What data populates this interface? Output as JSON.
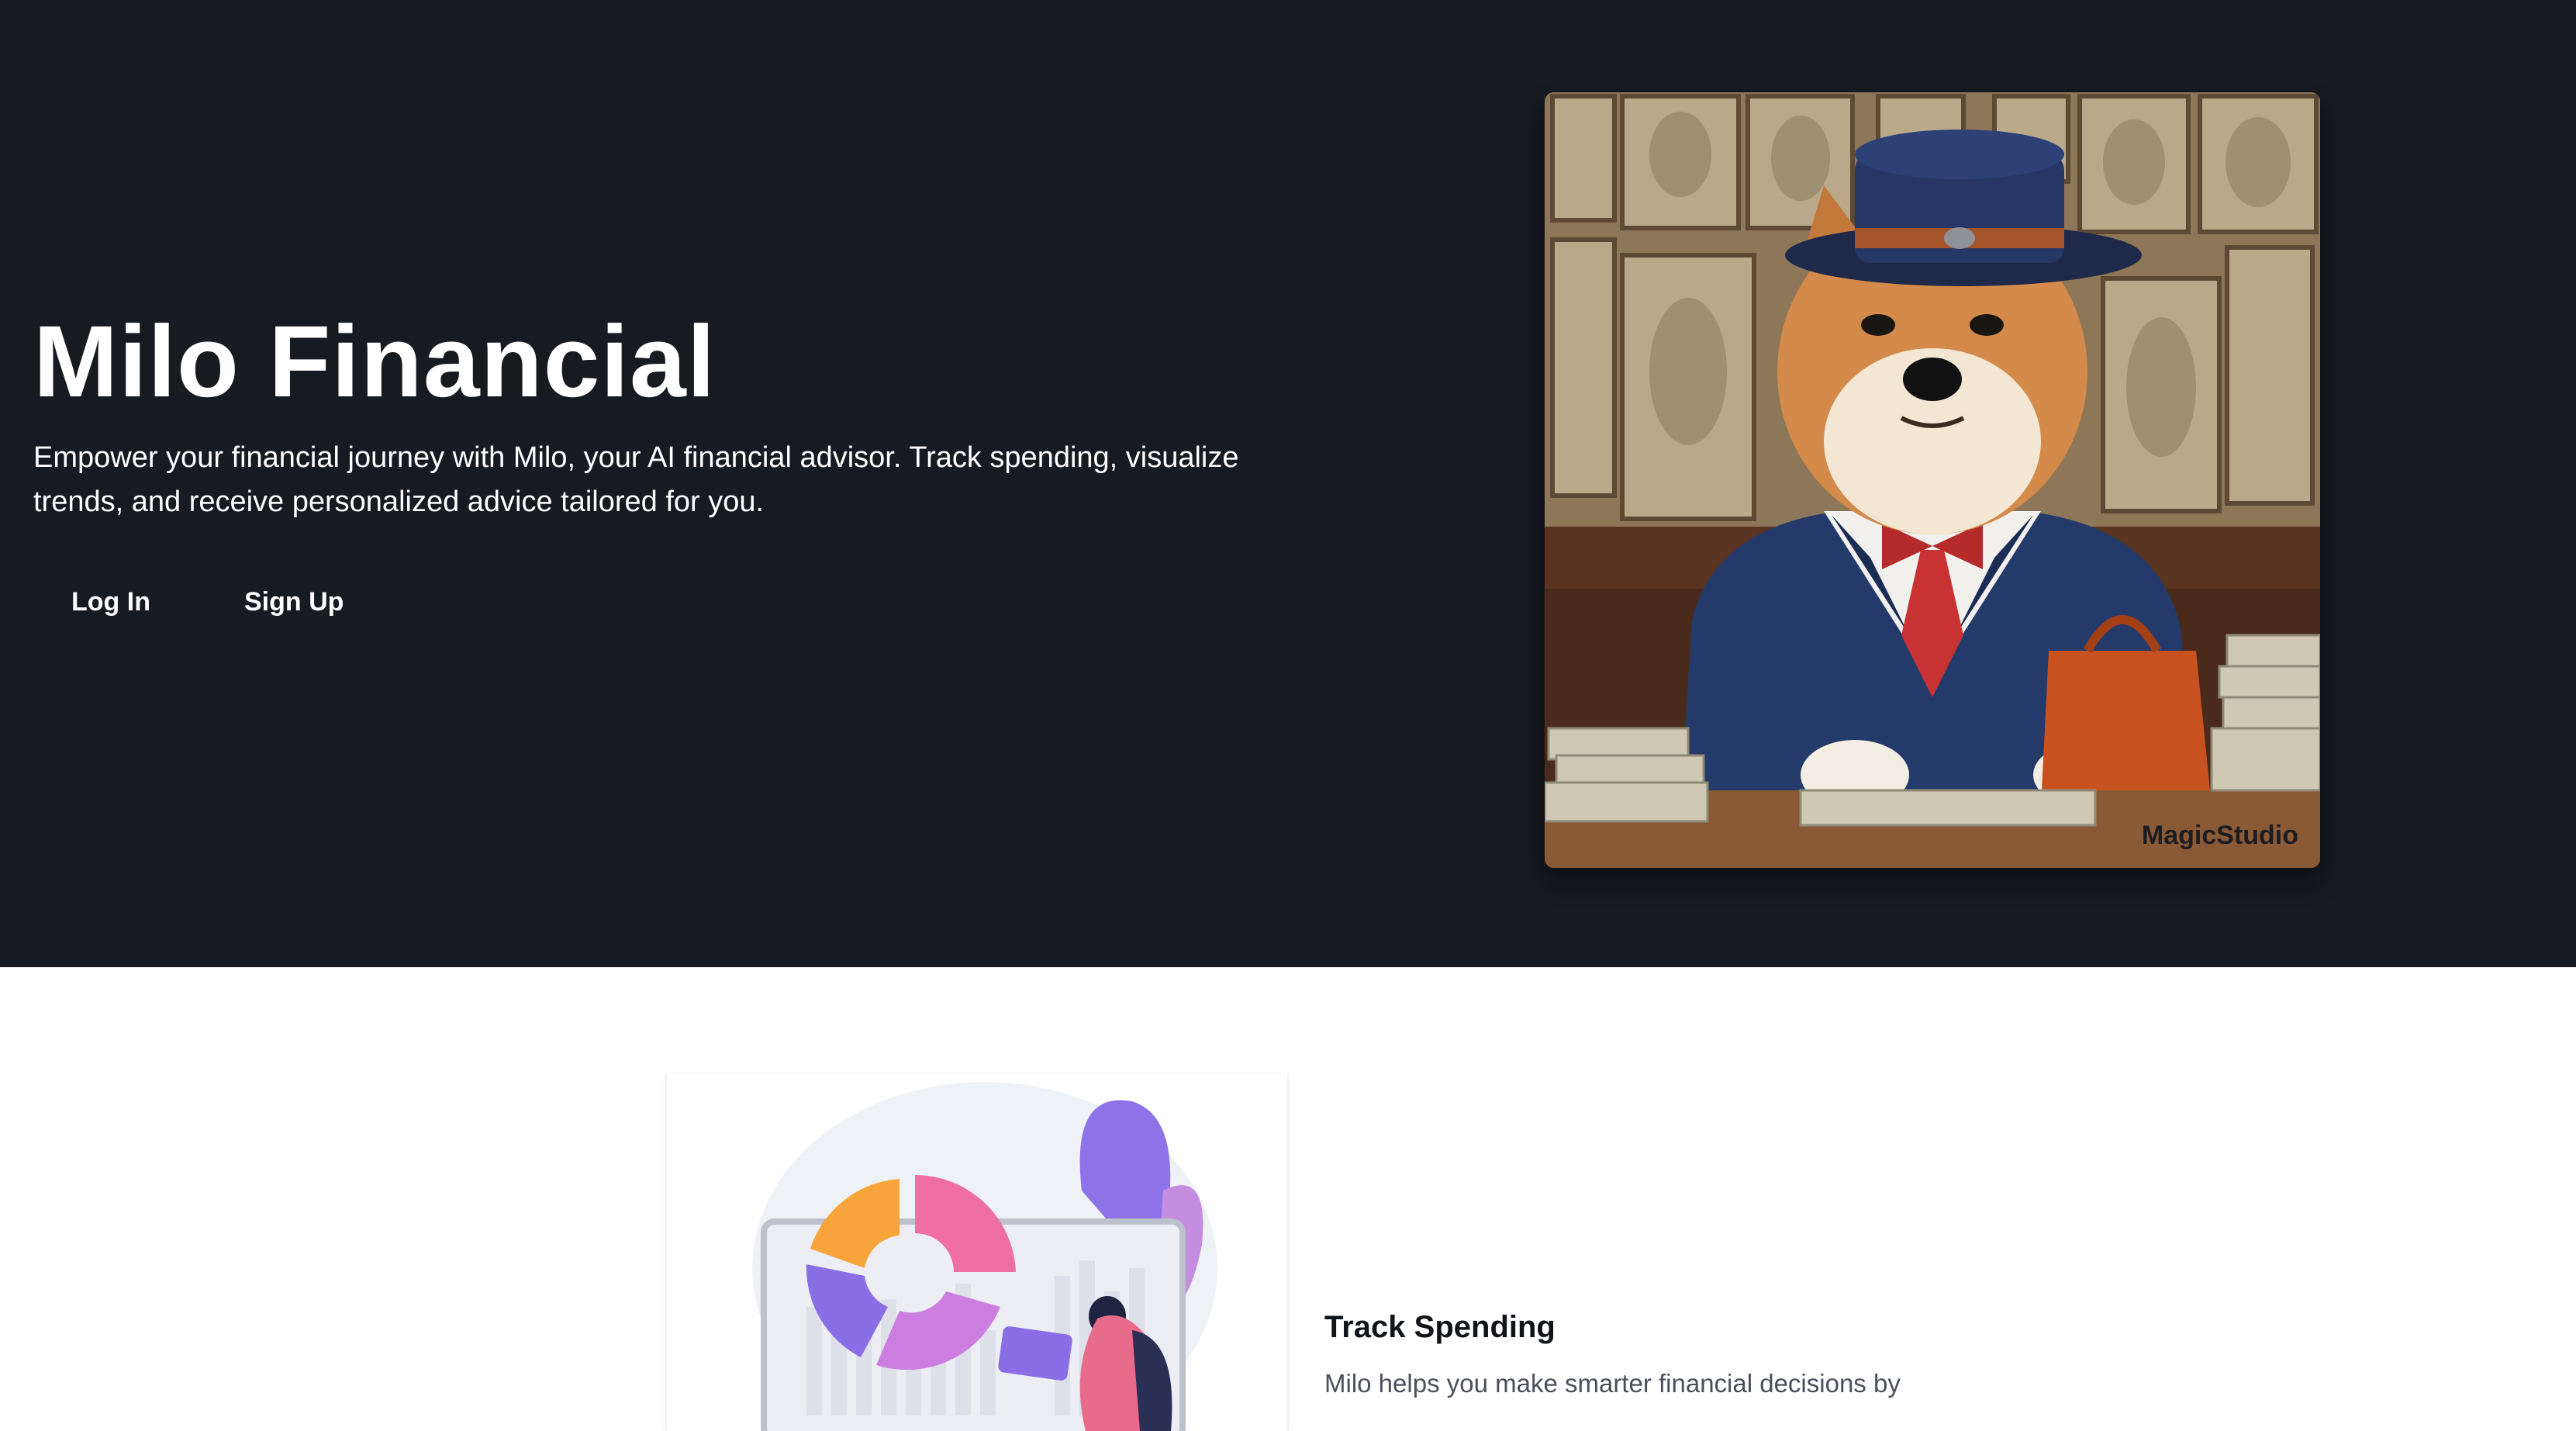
{
  "hero": {
    "title": "Milo Financial",
    "description": "Empower your financial journey with Milo, your AI financial advisor. Track spending, visualize trends, and receive personalized advice tailored for you.",
    "login_label": "Log In",
    "signup_label": "Sign Up",
    "image_watermark": "MagicStudio",
    "background_color": "#161a21"
  },
  "feature": {
    "title": "Track Spending",
    "description": "Milo helps you make smarter financial decisions by",
    "illustration": "spending-chart-illustration"
  }
}
